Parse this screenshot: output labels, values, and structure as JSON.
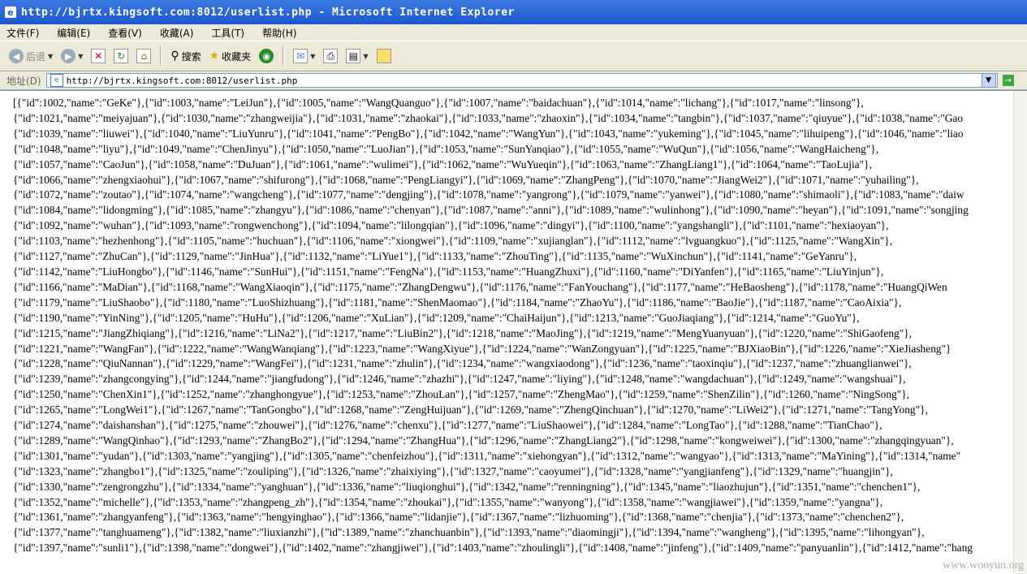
{
  "window": {
    "title": "http://bjrtx.kingsoft.com:8012/userlist.php - Microsoft Internet Explorer"
  },
  "menu": [
    "文件(F)",
    "编辑(E)",
    "查看(V)",
    "收藏(A)",
    "工具(T)",
    "帮助(H)"
  ],
  "toolbar": {
    "back": "后退",
    "search": "搜索",
    "favorites": "收藏夹"
  },
  "address": {
    "label": "地址(D)",
    "url": "http://bjrtx.kingsoft.com:8012/userlist.php"
  },
  "content": {
    "lines": [
      "[{\"id\":1002,\"name\":\"GeKe\"},{\"id\":1003,\"name\":\"LeiJun\"},{\"id\":1005,\"name\":\"WangQuanguo\"},{\"id\":1007,\"name\":\"baidachuan\"},{\"id\":1014,\"name\":\"lichang\"},{\"id\":1017,\"name\":\"linsong\"},",
      "{\"id\":1021,\"name\":\"meiyajuan\"},{\"id\":1030,\"name\":\"zhangweijia\"},{\"id\":1031,\"name\":\"zhaokai\"},{\"id\":1033,\"name\":\"zhaoxin\"},{\"id\":1034,\"name\":\"tangbin\"},{\"id\":1037,\"name\":\"qiuyue\"},{\"id\":1038,\"name\":\"Gao",
      "{\"id\":1039,\"name\":\"liuwei\"},{\"id\":1040,\"name\":\"LiuYunru\"},{\"id\":1041,\"name\":\"PengBo\"},{\"id\":1042,\"name\":\"WangYun\"},{\"id\":1043,\"name\":\"yukeming\"},{\"id\":1045,\"name\":\"lihuipeng\"},{\"id\":1046,\"name\":\"liao",
      "{\"id\":1048,\"name\":\"liyu\"},{\"id\":1049,\"name\":\"ChenJinyu\"},{\"id\":1050,\"name\":\"LuoJian\"},{\"id\":1053,\"name\":\"SunYanqiao\"},{\"id\":1055,\"name\":\"WuQun\"},{\"id\":1056,\"name\":\"WangHaicheng\"},",
      "{\"id\":1057,\"name\":\"CaoJun\"},{\"id\":1058,\"name\":\"DuJuan\"},{\"id\":1061,\"name\":\"wulimei\"},{\"id\":1062,\"name\":\"WuYueqin\"},{\"id\":1063,\"name\":\"ZhangLiang1\"},{\"id\":1064,\"name\":\"TaoLujia\"},",
      "{\"id\":1066,\"name\":\"zhengxiaohui\"},{\"id\":1067,\"name\":\"shifurong\"},{\"id\":1068,\"name\":\"PengLiangyi\"},{\"id\":1069,\"name\":\"ZhangPeng\"},{\"id\":1070,\"name\":\"JiangWei2\"},{\"id\":1071,\"name\":\"yuhailing\"},",
      "{\"id\":1072,\"name\":\"zoutao\"},{\"id\":1074,\"name\":\"wangcheng\"},{\"id\":1077,\"name\":\"dengjing\"},{\"id\":1078,\"name\":\"yangrong\"},{\"id\":1079,\"name\":\"yanwei\"},{\"id\":1080,\"name\":\"shimaoli\"},{\"id\":1083,\"name\":\"daiw",
      "{\"id\":1084,\"name\":\"lidongming\"},{\"id\":1085,\"name\":\"zhangyu\"},{\"id\":1086,\"name\":\"chenyan\"},{\"id\":1087,\"name\":\"anni\"},{\"id\":1089,\"name\":\"wulinhong\"},{\"id\":1090,\"name\":\"heyan\"},{\"id\":1091,\"name\":\"songjing",
      "{\"id\":1092,\"name\":\"wuhan\"},{\"id\":1093,\"name\":\"rongwenchong\"},{\"id\":1094,\"name\":\"lilongqian\"},{\"id\":1096,\"name\":\"dingyi\"},{\"id\":1100,\"name\":\"yangshangli\"},{\"id\":1101,\"name\":\"hexiaoyan\"},",
      "{\"id\":1103,\"name\":\"hezhenhong\"},{\"id\":1105,\"name\":\"huchuan\"},{\"id\":1106,\"name\":\"xiongwei\"},{\"id\":1109,\"name\":\"xujianglan\"},{\"id\":1112,\"name\":\"lvguangkuo\"},{\"id\":1125,\"name\":\"WangXin\"},",
      "{\"id\":1127,\"name\":\"ZhuCan\"},{\"id\":1129,\"name\":\"JinHua\"},{\"id\":1132,\"name\":\"LiYue1\"},{\"id\":1133,\"name\":\"ZhouTing\"},{\"id\":1135,\"name\":\"WuXinchun\"},{\"id\":1141,\"name\":\"GeYanru\"},",
      "{\"id\":1142,\"name\":\"LiuHongbo\"},{\"id\":1146,\"name\":\"SunHui\"},{\"id\":1151,\"name\":\"FengNa\"},{\"id\":1153,\"name\":\"HuangZhuxi\"},{\"id\":1160,\"name\":\"DiYanfen\"},{\"id\":1165,\"name\":\"LiuYinjun\"},",
      "{\"id\":1166,\"name\":\"MaDian\"},{\"id\":1168,\"name\":\"WangXiaoqin\"},{\"id\":1175,\"name\":\"ZhangDengwu\"},{\"id\":1176,\"name\":\"FanYouchang\"},{\"id\":1177,\"name\":\"HeBaosheng\"},{\"id\":1178,\"name\":\"HuangQiWen",
      "{\"id\":1179,\"name\":\"LiuShaobo\"},{\"id\":1180,\"name\":\"LuoShizhuang\"},{\"id\":1181,\"name\":\"ShenMaomao\"},{\"id\":1184,\"name\":\"ZhaoYu\"},{\"id\":1186,\"name\":\"BaoJie\"},{\"id\":1187,\"name\":\"CaoAixia\"},",
      "{\"id\":1190,\"name\":\"YinNing\"},{\"id\":1205,\"name\":\"HuHu\"},{\"id\":1206,\"name\":\"XuLian\"},{\"id\":1209,\"name\":\"ChaiHaijun\"},{\"id\":1213,\"name\":\"GuoJiaqiang\"},{\"id\":1214,\"name\":\"GuoYu\"},",
      "{\"id\":1215,\"name\":\"JiangZhiqiang\"},{\"id\":1216,\"name\":\"LiNa2\"},{\"id\":1217,\"name\":\"LiuBin2\"},{\"id\":1218,\"name\":\"MaoJing\"},{\"id\":1219,\"name\":\"MengYuanyuan\"},{\"id\":1220,\"name\":\"ShiGaofeng\"},",
      "{\"id\":1221,\"name\":\"WangFan\"},{\"id\":1222,\"name\":\"WangWanqiang\"},{\"id\":1223,\"name\":\"WangXiyue\"},{\"id\":1224,\"name\":\"WanZongyuan\"},{\"id\":1225,\"name\":\"BJXiaoBin\"},{\"id\":1226,\"name\":\"XieJiasheng\"}",
      "{\"id\":1228,\"name\":\"QiuNannan\"},{\"id\":1229,\"name\":\"WangFei\"},{\"id\":1231,\"name\":\"zhulin\"},{\"id\":1234,\"name\":\"wangxiaodong\"},{\"id\":1236,\"name\":\"taoxinqiu\"},{\"id\":1237,\"name\":\"zhuanglianwei\"},",
      "{\"id\":1239,\"name\":\"zhangcongying\"},{\"id\":1244,\"name\":\"jiangfudong\"},{\"id\":1246,\"name\":\"zhazhi\"},{\"id\":1247,\"name\":\"liying\"},{\"id\":1248,\"name\":\"wangdachuan\"},{\"id\":1249,\"name\":\"wangshuai\"},",
      "{\"id\":1250,\"name\":\"ChenXin1\"},{\"id\":1252,\"name\":\"zhanghongyue\"},{\"id\":1253,\"name\":\"ZhouLan\"},{\"id\":1257,\"name\":\"ZhengMao\"},{\"id\":1259,\"name\":\"ShenZilin\"},{\"id\":1260,\"name\":\"NingSong\"},",
      "{\"id\":1265,\"name\":\"LongWei1\"},{\"id\":1267,\"name\":\"TanGongbo\"},{\"id\":1268,\"name\":\"ZengHuijuan\"},{\"id\":1269,\"name\":\"ZhengQinchuan\"},{\"id\":1270,\"name\":\"LiWei2\"},{\"id\":1271,\"name\":\"TangYong\"},",
      "{\"id\":1274,\"name\":\"daishanshan\"},{\"id\":1275,\"name\":\"zhouwei\"},{\"id\":1276,\"name\":\"chenxu\"},{\"id\":1277,\"name\":\"LiuShaowei\"},{\"id\":1284,\"name\":\"LongTao\"},{\"id\":1288,\"name\":\"TianChao\"},",
      "{\"id\":1289,\"name\":\"WangQinhao\"},{\"id\":1293,\"name\":\"ZhangBo2\"},{\"id\":1294,\"name\":\"ZhangHua\"},{\"id\":1296,\"name\":\"ZhangLiang2\"},{\"id\":1298,\"name\":\"kongweiwei\"},{\"id\":1300,\"name\":\"zhangqingyuan\"},",
      "{\"id\":1301,\"name\":\"yudan\"},{\"id\":1303,\"name\":\"yangjing\"},{\"id\":1305,\"name\":\"chenfeizhou\"},{\"id\":1311,\"name\":\"xiehongyan\"},{\"id\":1312,\"name\":\"wangyao\"},{\"id\":1313,\"name\":\"MaYining\"},{\"id\":1314,\"name\"",
      "{\"id\":1323,\"name\":\"zhangbo1\"},{\"id\":1325,\"name\":\"zouliping\"},{\"id\":1326,\"name\":\"zhaixiying\"},{\"id\":1327,\"name\":\"caoyumei\"},{\"id\":1328,\"name\":\"yangjianfeng\"},{\"id\":1329,\"name\":\"huangjin\"},",
      "{\"id\":1330,\"name\":\"zengrongzhu\"},{\"id\":1334,\"name\":\"yanghuan\"},{\"id\":1336,\"name\":\"liuqionghui\"},{\"id\":1342,\"name\":\"renningning\"},{\"id\":1345,\"name\":\"liaozhujun\"},{\"id\":1351,\"name\":\"chenchen1\"},",
      "{\"id\":1352,\"name\":\"michelle\"},{\"id\":1353,\"name\":\"zhangpeng_zh\"},{\"id\":1354,\"name\":\"zhoukai\"},{\"id\":1355,\"name\":\"wanyong\"},{\"id\":1358,\"name\":\"wangjiawei\"},{\"id\":1359,\"name\":\"yangna\"},",
      "{\"id\":1361,\"name\":\"zhangyanfeng\"},{\"id\":1363,\"name\":\"hengyinghao\"},{\"id\":1366,\"name\":\"lidanjie\"},{\"id\":1367,\"name\":\"lizhuoming\"},{\"id\":1368,\"name\":\"chenjia\"},{\"id\":1373,\"name\":\"chenchen2\"},",
      "{\"id\":1377,\"name\":\"tanghuameng\"},{\"id\":1382,\"name\":\"liuxianzhi\"},{\"id\":1389,\"name\":\"zhanchuanbin\"},{\"id\":1393,\"name\":\"diaomingji\"},{\"id\":1394,\"name\":\"wangheng\"},{\"id\":1395,\"name\":\"lihongyan\"},",
      "{\"id\":1397,\"name\":\"sunli1\"},{\"id\":1398,\"name\":\"dongwei\"},{\"id\":1402,\"name\":\"zhangjiwei\"},{\"id\":1403,\"name\":\"zhoulingli\"},{\"id\":1408,\"name\":\"jinfeng\"},{\"id\":1409,\"name\":\"panyuanlin\"},{\"id\":1412,\"name\":\"hang"
    ]
  },
  "watermark": "www.wooyun.org"
}
